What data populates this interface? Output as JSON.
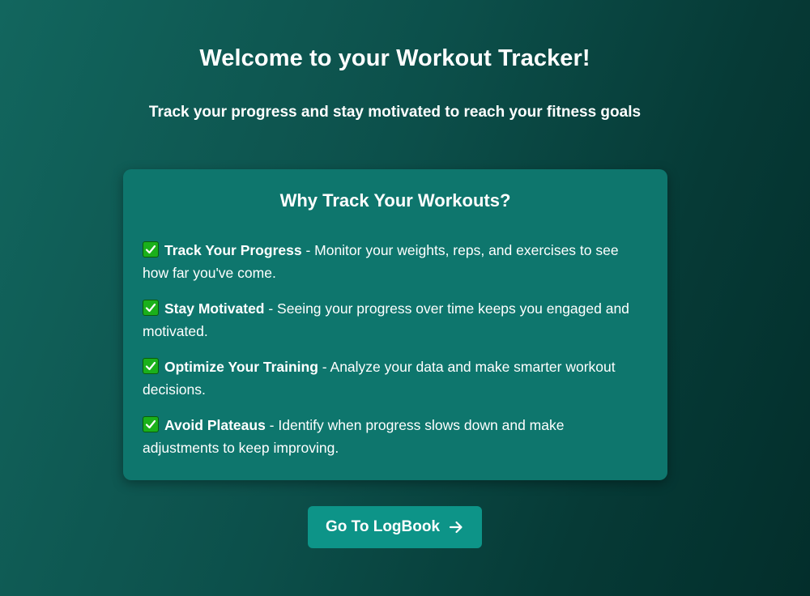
{
  "header": {
    "title": "Welcome to your Workout Tracker!",
    "subtitle": "Track your progress and stay motivated to reach your fitness goals"
  },
  "card": {
    "title": "Why Track Your Workouts?",
    "items": [
      {
        "icon": "check-mark-icon",
        "title": "Track Your Progress",
        "description": " - Monitor your weights, reps, and exercises to see how far you've come."
      },
      {
        "icon": "check-mark-icon",
        "title": "Stay Motivated",
        "description": " - Seeing your progress over time keeps you engaged and motivated."
      },
      {
        "icon": "check-mark-icon",
        "title": "Optimize Your Training",
        "description": " - Analyze your data and make smarter workout decisions."
      },
      {
        "icon": "check-mark-icon",
        "title": "Avoid Plateaus",
        "description": " - Identify when progress slows down and make adjustments to keep improving."
      }
    ]
  },
  "cta": {
    "label": "Go To LogBook",
    "icon": "arrow-right-icon"
  },
  "colors": {
    "background_start": "#12665e",
    "background_end": "#032e2b",
    "card_background": "#0e766d",
    "button_background": "#0d9488",
    "check_green": "#1bb01b",
    "text": "#ffffff"
  }
}
